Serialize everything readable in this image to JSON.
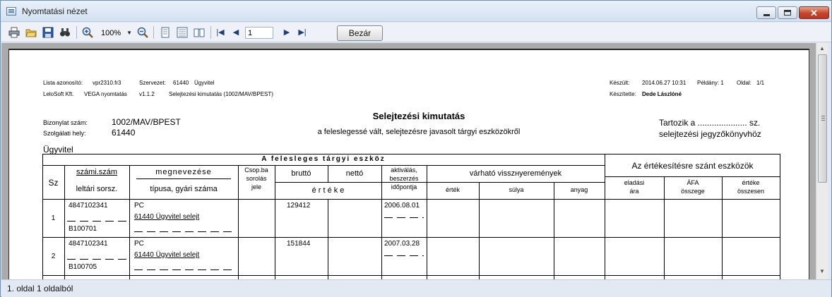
{
  "window": {
    "title": "Nyomtatási nézet"
  },
  "toolbar": {
    "zoom_value": "100%",
    "page_value": "1",
    "close_label": "Bezár"
  },
  "status": {
    "text": "1. oldal 1 oldalból"
  },
  "report": {
    "header_left": {
      "line1": [
        "Lista azonosító:",
        "vpr2310.fr3",
        "Szervezet:",
        "61440",
        "Ügyvitel"
      ],
      "line2": [
        "LeloSoft Kft.",
        "VEGA nyomtatás",
        "v1.1.2",
        "Selejtezési kimutatás (1002/MAV/BPEST)"
      ]
    },
    "header_right": {
      "created_label": "Készült:",
      "created_value": "2014.06.27 10:31",
      "copies_label": "Példány: 1",
      "page_label": "Oldal:",
      "page_value": "1/1",
      "author_label": "Készítette:",
      "author_value": "Dede Lászlóné"
    },
    "doc_number_label": "Bizonylat szám:",
    "doc_number_value": "1002/MAV/BPEST",
    "service_place_label": "Szolgálati hely:",
    "service_place_value": "61440",
    "unit": "Ügyvitel",
    "title": "Selejtezési kimutatás",
    "subtitle": "a feleslegessé vált, selejtezésre javasolt tárgyi eszközökről",
    "belongs_line1": "Tartozik a ..................... sz.",
    "belongs_line2": "selejtezési jegyzőkönyvhöz",
    "table": {
      "group_left": "A felesleges tárgyi eszköz",
      "group_right": "Az értékesítésre szánt eszközök",
      "sz": "Sz",
      "szam_top": "számi.szám",
      "szam_bottom": "leltári sorsz.",
      "megnev_top": "megnevezése",
      "megnev_bottom": "típusa, gyári száma",
      "csop": [
        "Csop.ba",
        "sorolás",
        "jele"
      ],
      "brutto": "bruttó",
      "netto": "nettó",
      "ertek": "é r t é k e",
      "aktivalas": [
        "aktiválás,",
        "beszerzés",
        "időpontja"
      ],
      "varhato": "várható visszнyeremények",
      "ertek_sub": "érték",
      "sulya": "súlya",
      "anyag": "anyag",
      "eladasi": [
        "eladási",
        "ára"
      ],
      "afa": [
        "ÁFA",
        "összege"
      ],
      "ertek_osszesen": [
        "értéke",
        "összesen"
      ]
    },
    "rows": [
      {
        "no": "1",
        "szam": "4847102341",
        "leltari": "B100701",
        "megnev": "PC",
        "tipus": "61440 Ügyvitel selejt",
        "brutto": "129412",
        "datum": "2006.08.01"
      },
      {
        "no": "2",
        "szam": "4847102341",
        "leltari": "B100705",
        "megnev": "PC",
        "tipus": "61440 Ügyvitel selejt",
        "brutto": "151844",
        "datum": "2007.03.28"
      }
    ]
  }
}
